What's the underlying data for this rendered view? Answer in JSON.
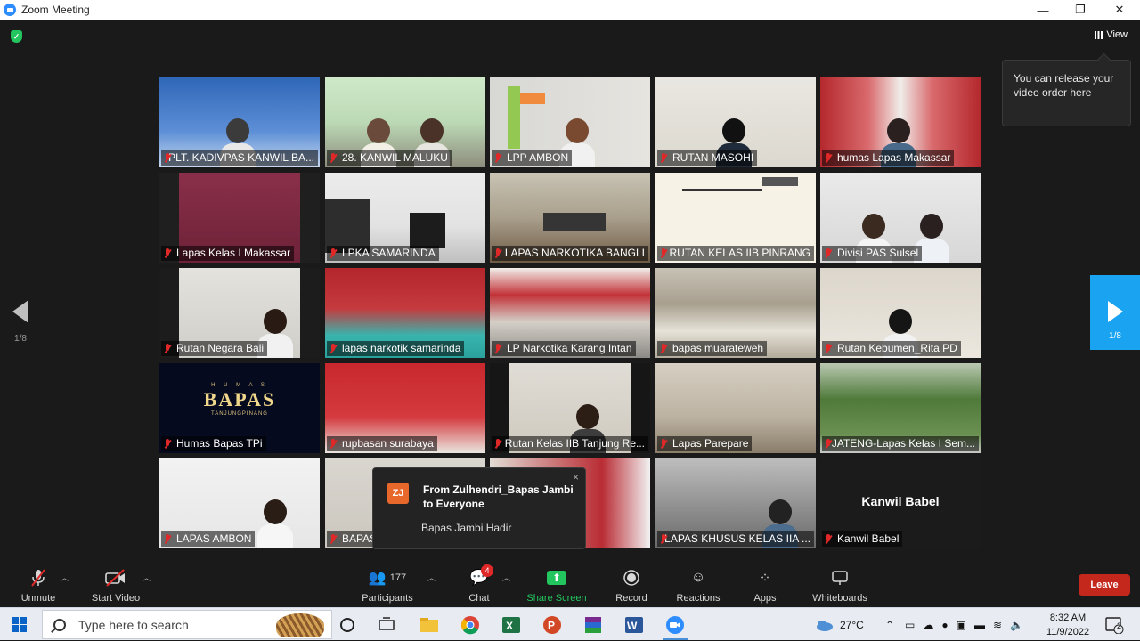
{
  "window": {
    "title": "Zoom Meeting",
    "controls": {
      "minimize": "—",
      "restore": "❐",
      "close": "✕"
    }
  },
  "top": {
    "view_label": "View",
    "tooltip": "You can release your video order here"
  },
  "pagination": {
    "left": "1/8",
    "right": "1/8"
  },
  "tiles": [
    {
      "name": "PLT. KADIVPAS KANWIL BA..."
    },
    {
      "name": "28. KANWIL MALUKU"
    },
    {
      "name": "LPP AMBON"
    },
    {
      "name": "RUTAN MASOHI"
    },
    {
      "name": "humas Lapas Makassar"
    },
    {
      "name": "Lapas Kelas I Makassar"
    },
    {
      "name": "LPKA SAMARINDA"
    },
    {
      "name": "LAPAS NARKOTIKA BANGLI"
    },
    {
      "name": "RUTAN KELAS IIB PINRANG"
    },
    {
      "name": "Divisi PAS Sulsel"
    },
    {
      "name": "Rutan Negara Bali"
    },
    {
      "name": "lapas narkotik samarinda"
    },
    {
      "name": "LP Narkotika Karang Intan"
    },
    {
      "name": "bapas muarateweh"
    },
    {
      "name": "Rutan Kebumen_Rita PD"
    },
    {
      "name": "Humas Bapas TPi",
      "logo": {
        "top": "H U M A S",
        "main": "BAPAS",
        "sub": "TANJUNGPINANG"
      }
    },
    {
      "name": "rupbasan surabaya"
    },
    {
      "name": "Rutan Kelas IIB Tanjung Re..."
    },
    {
      "name": "Lapas Parepare"
    },
    {
      "name": "JATENG-Lapas Kelas I Sem..."
    },
    {
      "name": "LAPAS AMBON"
    },
    {
      "name": "BAPAS"
    },
    {
      "name": ""
    },
    {
      "name": "LAPAS KHUSUS KELAS IIA ..."
    },
    {
      "name": "Kanwil Babel",
      "center": "Kanwil Babel"
    }
  ],
  "chat_popup": {
    "avatar": "ZJ",
    "from": "From Zulhendri_Bapas Jambi to Everyone",
    "message": "Bapas Jambi Hadir",
    "close": "×"
  },
  "toolbar": {
    "unmute": "Unmute",
    "start_video": "Start Video",
    "participants": "Participants",
    "participants_count": "177",
    "chat": "Chat",
    "chat_badge": "4",
    "share_screen": "Share Screen",
    "record": "Record",
    "reactions": "Reactions",
    "apps": "Apps",
    "whiteboards": "Whiteboards",
    "leave": "Leave"
  },
  "taskbar": {
    "search_placeholder": "Type here to search",
    "weather": "27°C",
    "time": "8:32 AM",
    "date": "11/9/2022",
    "notif_count": "2"
  },
  "colors": {
    "accent_blue": "#1aa3f0",
    "leave_red": "#c4281c",
    "share_green": "#23c55e"
  }
}
